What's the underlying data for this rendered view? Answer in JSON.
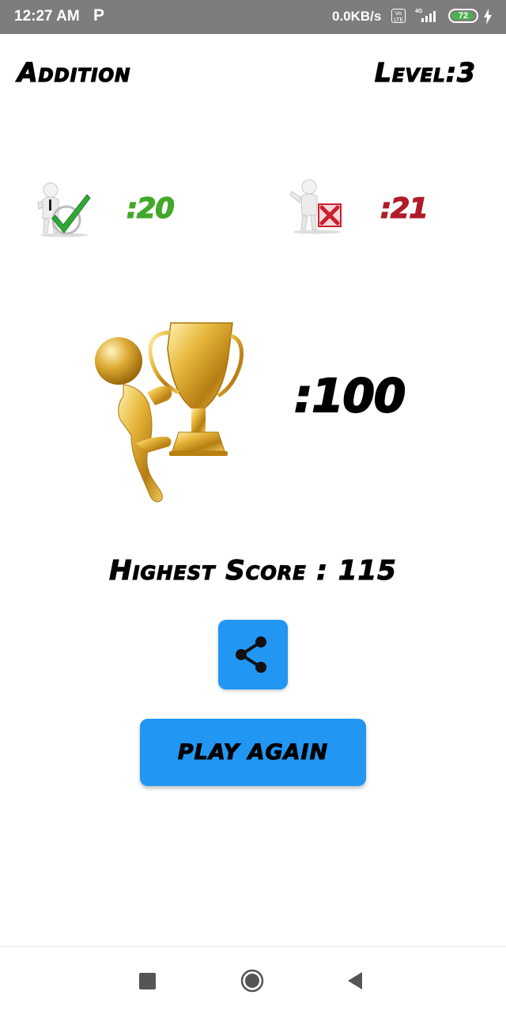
{
  "status_bar": {
    "time": "12:27 AM",
    "app_indicator": "P",
    "network_speed": "0.0KB/s",
    "volte": "Vo LTE",
    "signal_label": "4G",
    "battery": "72"
  },
  "header": {
    "mode": "Addition",
    "level": "Level:3"
  },
  "stats": {
    "correct_count": ":20",
    "wrong_count": ":21",
    "correct_icon": "man-with-checkmark-icon",
    "wrong_icon": "man-with-cross-icon"
  },
  "score": {
    "value": ":100",
    "trophy_icon": "gold-trophy-figure-icon"
  },
  "highest_score": {
    "text": "Highest Score : 115"
  },
  "actions": {
    "share_icon": "share-icon",
    "play_again_label": "PLAY AGAIN"
  },
  "colors": {
    "correct": "#43a829",
    "wrong": "#b01c28",
    "button": "#2196f3",
    "status_bar": "#7d7d7d"
  }
}
